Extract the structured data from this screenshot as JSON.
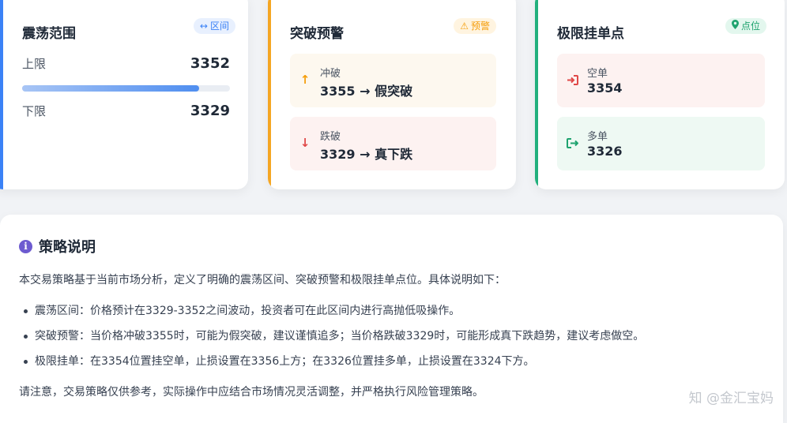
{
  "range_card": {
    "title": "震荡范围",
    "badge_icon": "↔",
    "badge_text": "区间",
    "upper_label": "上限",
    "upper_value": "3352",
    "lower_label": "下限",
    "lower_value": "3329",
    "bar_fraction": 0.85,
    "accent": "#3b82f6"
  },
  "breakout_card": {
    "title": "突破预警",
    "badge_icon": "⚠",
    "badge_text": "预警",
    "accent": "#f5a623",
    "items": [
      {
        "icon": "arrow-up-icon",
        "glyph": "↑",
        "color": "#f59e0b",
        "label": "冲破",
        "value": "3355 → 假突破"
      },
      {
        "icon": "arrow-down-icon",
        "glyph": "↓",
        "color": "#e04848",
        "label": "跌破",
        "value": "3329 → 真下跌"
      }
    ]
  },
  "limit_card": {
    "title": "极限挂单点",
    "badge_icon": "📍",
    "badge_text": "点位",
    "accent": "#22b07d",
    "items": [
      {
        "icon": "sign-in-icon",
        "glyph": "⇥",
        "color": "#e04848",
        "label": "空单",
        "value": "3354"
      },
      {
        "icon": "sign-out-icon",
        "glyph": "⇥",
        "color": "#1fa36f",
        "label": "多单",
        "value": "3326"
      }
    ]
  },
  "strategy": {
    "title": "策略说明",
    "intro": "本交易策略基于当前市场分析，定义了明确的震荡区间、突破预警和极限挂单点位。具体说明如下：",
    "bullets": [
      "震荡区间：价格预计在3329-3352之间波动，投资者可在此区间内进行高抛低吸操作。",
      "突破预警：当价格冲破3355时，可能为假突破，建议谨慎追多；当价格跌破3329时，可能形成真下跌趋势，建议考虑做空。",
      "极限挂单：在3354位置挂空单，止损设置在3356上方；在3326位置挂多单，止损设置在3324下方。"
    ],
    "note": "请注意，交易策略仅供参考，实际操作中应结合市场情况灵活调整，并严格执行风险管理策略。"
  },
  "watermark": "知 @金汇宝妈"
}
